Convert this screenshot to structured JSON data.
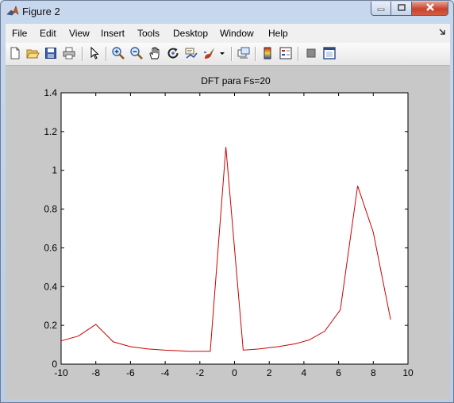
{
  "window": {
    "title": "Figure 2",
    "controls": {
      "minimize_icon": "minimize-icon",
      "maximize_icon": "maximize-icon",
      "close_icon": "close-icon"
    }
  },
  "menu": [
    "File",
    "Edit",
    "View",
    "Insert",
    "Tools",
    "Desktop",
    "Window",
    "Help"
  ],
  "toolbar": {
    "icons": [
      "new-figure-icon",
      "open-file-icon",
      "save-icon",
      "print-icon",
      "edit-plot-arrow-icon",
      "zoom-in-icon",
      "zoom-out-icon",
      "pan-hand-icon",
      "rotate-3d-icon",
      "data-cursor-icon",
      "brush-icon",
      "brush-dropdown-icon",
      "link-plot-icon",
      "colorbar-icon",
      "legend-icon",
      "hide-plot-tools-icon",
      "show-plot-tools-icon"
    ]
  },
  "chart_data": {
    "type": "line",
    "title": "DFT para Fs=20",
    "xlabel": "",
    "ylabel": "",
    "xlim": [
      -10,
      10
    ],
    "ylim": [
      0,
      1.4
    ],
    "xticks": [
      "-10",
      "-8",
      "-6",
      "-4",
      "-2",
      "0",
      "2",
      "4",
      "6",
      "8",
      "10"
    ],
    "yticks": [
      "0",
      "0.2",
      "0.4",
      "0.6",
      "0.8",
      "1",
      "1.2",
      "1.4"
    ],
    "grid": false,
    "legend": "none",
    "series": [
      {
        "color": "#cc0000",
        "x": [
          -10,
          -9,
          -8,
          -7,
          -6,
          -5,
          -4,
          -3,
          -2.7,
          -1.4,
          -0.5,
          0.5,
          1.4,
          2.5,
          3.5,
          4.3,
          5.2,
          6.1,
          7.1,
          8.0,
          9.0
        ],
        "y": [
          0.12,
          0.145,
          0.205,
          0.115,
          0.09,
          0.078,
          0.072,
          0.068,
          0.066,
          0.066,
          1.12,
          0.072,
          0.078,
          0.09,
          0.105,
          0.125,
          0.17,
          0.28,
          0.92,
          0.68,
          0.23
        ]
      }
    ]
  }
}
